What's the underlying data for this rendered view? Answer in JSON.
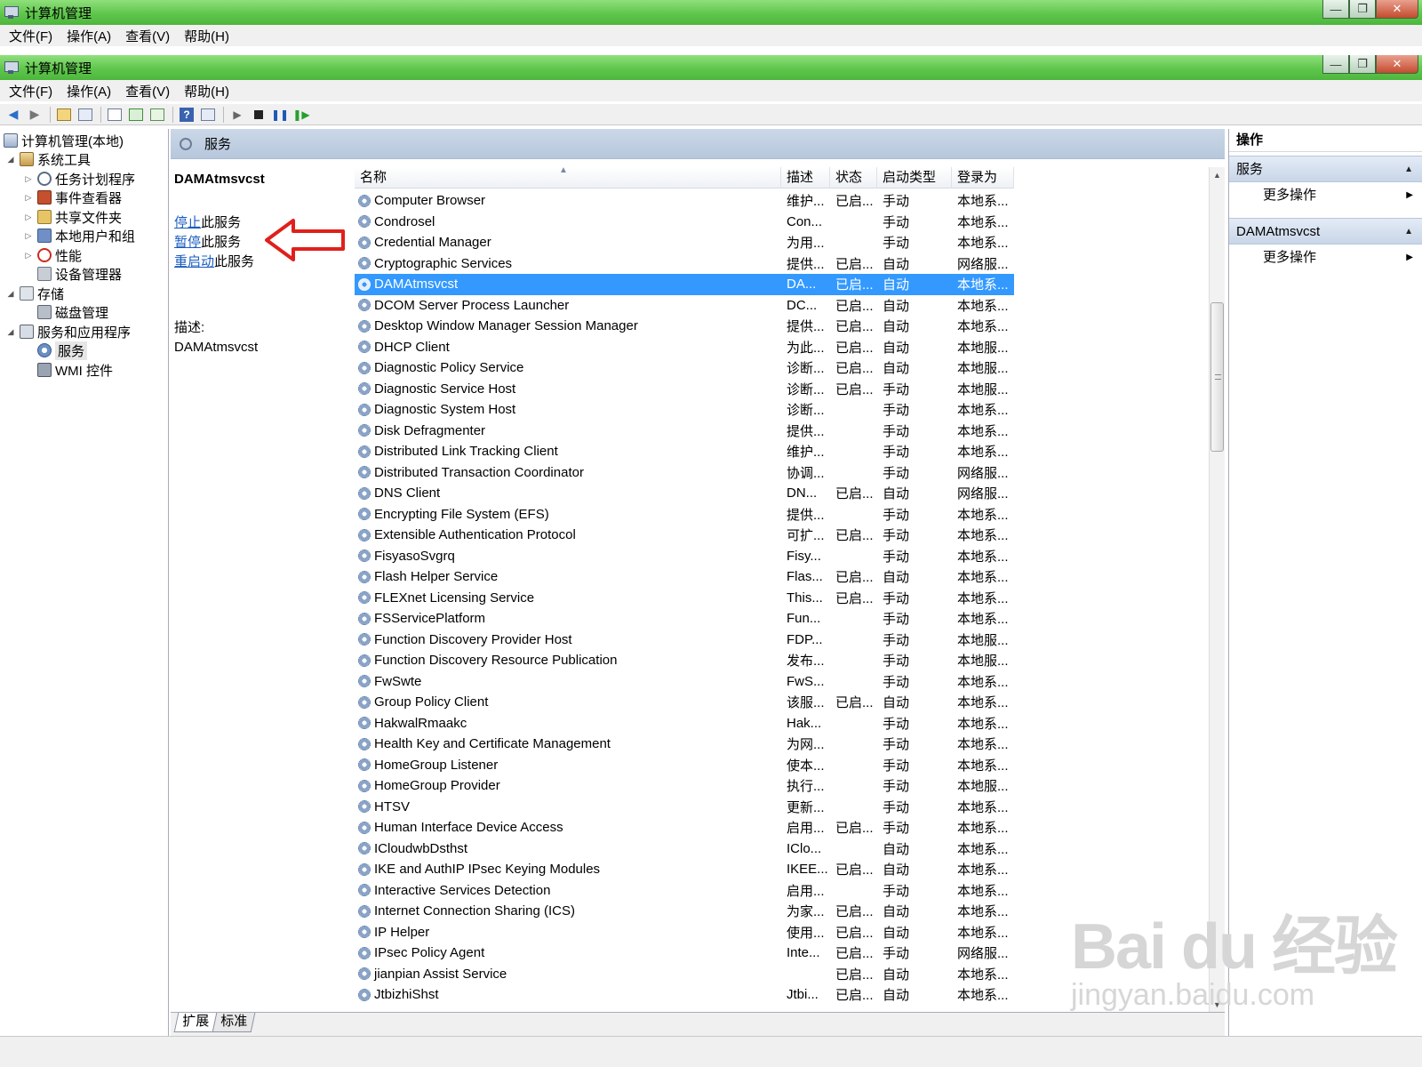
{
  "window": {
    "title": "计算机管理",
    "minimize_label": "—",
    "maximize_label": "❐",
    "close_label": "✕"
  },
  "menu": [
    "文件(F)",
    "操作(A)",
    "查看(V)",
    "帮助(H)"
  ],
  "toolbar_icons": [
    "back-icon",
    "forward-icon",
    "up-folder-icon",
    "show-hide-tree-icon",
    "properties-icon",
    "refresh-icon",
    "export-icon",
    "help-icon",
    "console-icon",
    "start-service-icon",
    "stop-service-icon",
    "pause-service-icon",
    "resume-service-icon"
  ],
  "tree": {
    "root": "计算机管理(本地)",
    "system_tools": "系统工具",
    "task_scheduler": "任务计划程序",
    "event_viewer": "事件查看器",
    "shared_folders": "共享文件夹",
    "local_users": "本地用户和组",
    "performance": "性能",
    "device_manager": "设备管理器",
    "storage": "存储",
    "disk_management": "磁盘管理",
    "services_apps": "服务和应用程序",
    "services": "服务",
    "wmi": "WMI 控件"
  },
  "center": {
    "header": "服务",
    "selected_service": "DAMAtmsvcst",
    "actions": [
      {
        "link": "停止",
        "suffix": "此服务"
      },
      {
        "link": "暂停",
        "suffix": "此服务"
      },
      {
        "link": "重启动",
        "suffix": "此服务"
      }
    ],
    "desc_label": "描述:",
    "desc_text": "DAMAtmsvcst"
  },
  "table": {
    "columns": [
      "名称",
      "描述",
      "状态",
      "启动类型",
      "登录为"
    ],
    "rows": [
      [
        "Computer Browser",
        "维护...",
        "已启...",
        "手动",
        "本地系..."
      ],
      [
        "Condrosel",
        "Con...",
        "",
        "手动",
        "本地系..."
      ],
      [
        "Credential Manager",
        "为用...",
        "",
        "手动",
        "本地系..."
      ],
      [
        "Cryptographic Services",
        "提供...",
        "已启...",
        "自动",
        "网络服..."
      ],
      [
        "DAMAtmsvcst",
        "DA...",
        "已启...",
        "自动",
        "本地系..."
      ],
      [
        "DCOM Server Process Launcher",
        "DC...",
        "已启...",
        "自动",
        "本地系..."
      ],
      [
        "Desktop Window Manager Session Manager",
        "提供...",
        "已启...",
        "自动",
        "本地系..."
      ],
      [
        "DHCP Client",
        "为此...",
        "已启...",
        "自动",
        "本地服..."
      ],
      [
        "Diagnostic Policy Service",
        "诊断...",
        "已启...",
        "自动",
        "本地服..."
      ],
      [
        "Diagnostic Service Host",
        "诊断...",
        "已启...",
        "手动",
        "本地服..."
      ],
      [
        "Diagnostic System Host",
        "诊断...",
        "",
        "手动",
        "本地系..."
      ],
      [
        "Disk Defragmenter",
        "提供...",
        "",
        "手动",
        "本地系..."
      ],
      [
        "Distributed Link Tracking Client",
        "维护...",
        "",
        "手动",
        "本地系..."
      ],
      [
        "Distributed Transaction Coordinator",
        "协调...",
        "",
        "手动",
        "网络服..."
      ],
      [
        "DNS Client",
        "DN...",
        "已启...",
        "自动",
        "网络服..."
      ],
      [
        "Encrypting File System (EFS)",
        "提供...",
        "",
        "手动",
        "本地系..."
      ],
      [
        "Extensible Authentication Protocol",
        "可扩...",
        "已启...",
        "手动",
        "本地系..."
      ],
      [
        "FisyasoSvgrq",
        "Fisy...",
        "",
        "手动",
        "本地系..."
      ],
      [
        "Flash Helper Service",
        "Flas...",
        "已启...",
        "自动",
        "本地系..."
      ],
      [
        "FLEXnet Licensing Service",
        "This...",
        "已启...",
        "手动",
        "本地系..."
      ],
      [
        "FSServicePlatform",
        "Fun...",
        "",
        "手动",
        "本地系..."
      ],
      [
        "Function Discovery Provider Host",
        "FDP...",
        "",
        "手动",
        "本地服..."
      ],
      [
        "Function Discovery Resource Publication",
        "发布...",
        "",
        "手动",
        "本地服..."
      ],
      [
        "FwSwte",
        "FwS...",
        "",
        "手动",
        "本地系..."
      ],
      [
        "Group Policy Client",
        "该服...",
        "已启...",
        "自动",
        "本地系..."
      ],
      [
        "HakwalRmaakc",
        "Hak...",
        "",
        "手动",
        "本地系..."
      ],
      [
        "Health Key and Certificate Management",
        "为网...",
        "",
        "手动",
        "本地系..."
      ],
      [
        "HomeGroup Listener",
        "使本...",
        "",
        "手动",
        "本地系..."
      ],
      [
        "HomeGroup Provider",
        "执行...",
        "",
        "手动",
        "本地服..."
      ],
      [
        "HTSV",
        "更新...",
        "",
        "手动",
        "本地系..."
      ],
      [
        "Human Interface Device Access",
        "启用...",
        "已启...",
        "手动",
        "本地系..."
      ],
      [
        "ICloudwbDsthst",
        "IClo...",
        "",
        "自动",
        "本地系..."
      ],
      [
        "IKE and AuthIP IPsec Keying Modules",
        "IKEE...",
        "已启...",
        "自动",
        "本地系..."
      ],
      [
        "Interactive Services Detection",
        "启用...",
        "",
        "手动",
        "本地系..."
      ],
      [
        "Internet Connection Sharing (ICS)",
        "为家...",
        "已启...",
        "自动",
        "本地系..."
      ],
      [
        "IP Helper",
        "使用...",
        "已启...",
        "自动",
        "本地系..."
      ],
      [
        "IPsec Policy Agent",
        "Inte...",
        "已启...",
        "手动",
        "网络服..."
      ],
      [
        "jianpian Assist Service",
        "",
        "已启...",
        "自动",
        "本地系..."
      ],
      [
        "JtbizhiShst",
        "Jtbi...",
        "已启...",
        "自动",
        "本地系..."
      ]
    ],
    "selected_index": 4
  },
  "bottom_tabs": [
    "扩展",
    "标准"
  ],
  "actions_pane": {
    "header": "操作",
    "section1": "服务",
    "more1": "更多操作",
    "section2": "DAMAtmsvcst",
    "more2": "更多操作"
  },
  "watermark": {
    "main": "Bai du 经验",
    "sub": "jingyan.baidu.com"
  },
  "colors": {
    "titlebar": "#5fc64c",
    "selection": "#3399ff",
    "link": "#1a5cc1",
    "annotation_arrow": "#e0201a"
  }
}
